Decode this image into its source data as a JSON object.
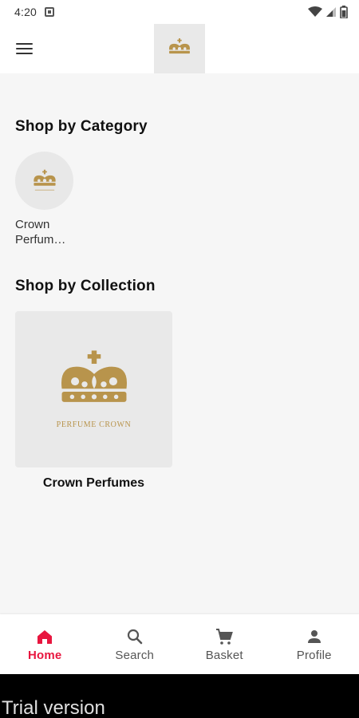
{
  "status_bar": {
    "time": "4:20"
  },
  "app_bar": {
    "menu_icon": "menu-icon",
    "logo_icon": "crown-logo-icon"
  },
  "categories": {
    "title": "Shop by Category",
    "items": [
      {
        "label": "Crown\nPerfum…",
        "icon": "crown-logo-icon"
      }
    ]
  },
  "collections": {
    "title": "Shop by Collection",
    "items": [
      {
        "label": "Crown Perfumes",
        "brand_text": "PERFUME CROWN",
        "icon": "crown-icon"
      }
    ]
  },
  "bottom_nav": {
    "items": [
      {
        "label": "Home",
        "icon": "home-icon",
        "active": true
      },
      {
        "label": "Search",
        "icon": "search-icon",
        "active": false
      },
      {
        "label": "Basket",
        "icon": "cart-icon",
        "active": false
      },
      {
        "label": "Profile",
        "icon": "person-icon",
        "active": false
      }
    ]
  },
  "footer": {
    "trial_text": "Trial version"
  },
  "colors": {
    "accent": "#e8163f",
    "gold": "#b8944c",
    "background": "#f6f6f6"
  }
}
